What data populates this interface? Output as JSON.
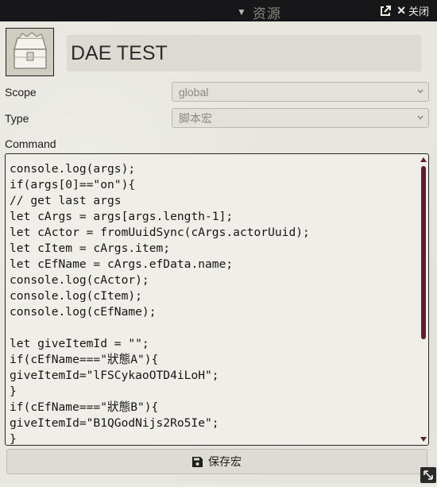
{
  "header": {
    "title": "资源",
    "close_label": "关闭"
  },
  "item": {
    "name": "DAE TEST",
    "avatar_icon": "treasure-chest-icon"
  },
  "fields": {
    "scope_label": "Scope",
    "scope_value": "global",
    "type_label": "Type",
    "type_value": "脚本宏",
    "command_label": "Command"
  },
  "command_code": "console.log(args);\nif(args[0]==\"on\"){\n// get last args\nlet cArgs = args[args.length-1];\nlet cActor = fromUuidSync(cArgs.actorUuid);\nlet cItem = cArgs.item;\nlet cEfName = cArgs.efData.name;\nconsole.log(cActor);\nconsole.log(cItem);\nconsole.log(cEfName);\n\nlet giveItemId = \"\";\nif(cEfName===\"狀態A\"){\ngiveItemId=\"lFSCykaoOTD4iLoH\";\n}\nif(cEfName===\"狀態B\"){\ngiveItemId=\"B1QGodNijs2Ro5Ie\";\n}",
  "footer": {
    "save_label": "保存宏"
  },
  "colors": {
    "header_bg": "#17171a",
    "scrollbar_thumb": "#5c1e33"
  }
}
